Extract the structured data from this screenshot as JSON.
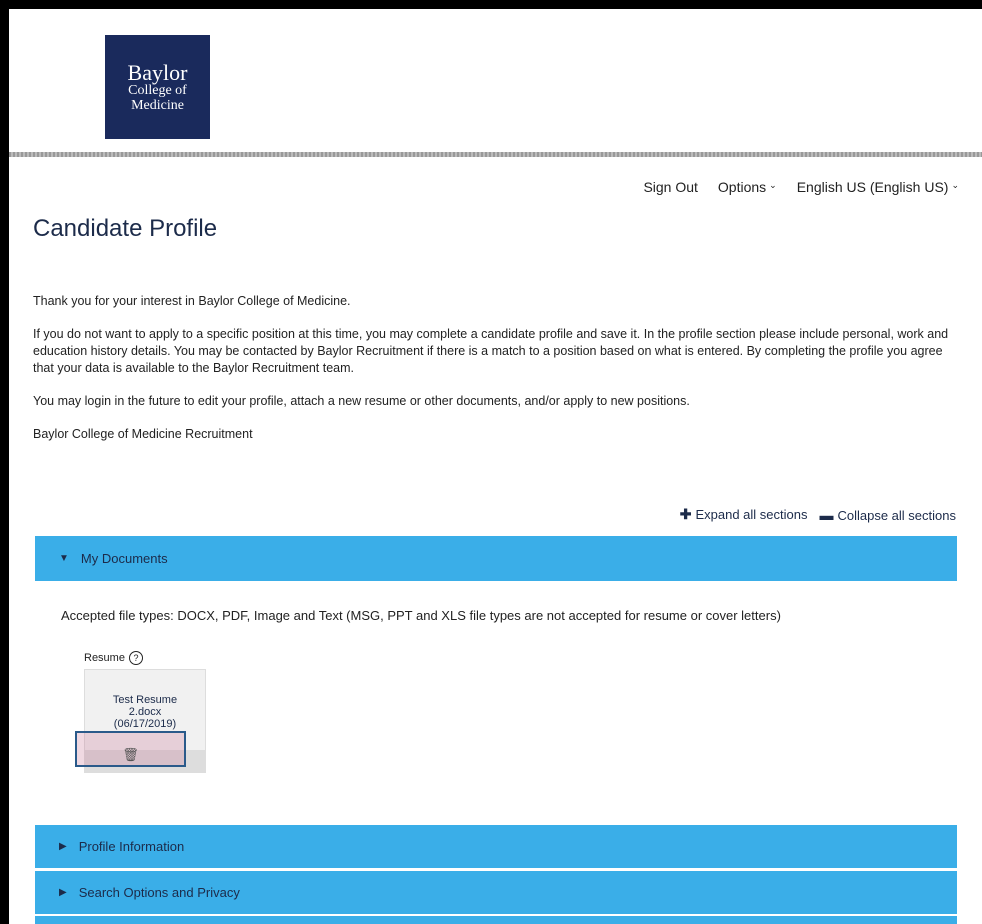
{
  "logo": {
    "line1": "Baylor",
    "line2": "College of",
    "line3": "Medicine"
  },
  "nav": {
    "sign_out": "Sign Out",
    "options": "Options",
    "language": "English US (English US)"
  },
  "page_title": "Candidate Profile",
  "intro": [
    "Thank you for your interest in Baylor College of Medicine.",
    "If you do not want to apply to a specific position at this time, you may complete a candidate profile and save it. In the profile section please include personal, work and education history details. You may be contacted by Baylor Recruitment if there is a match to a position based on what is entered. By completing the profile you agree that your data is available to the Baylor Recruitment team.",
    "You may login in the future to edit your profile, attach a new resume or other documents, and/or apply to new positions.",
    "Baylor College of Medicine Recruitment"
  ],
  "toggles": {
    "expand": "Expand all sections",
    "collapse": "Collapse all sections"
  },
  "sections": {
    "documents": "My Documents",
    "profile": "Profile Information",
    "search": "Search Options and Privacy"
  },
  "documents": {
    "accepted_types": "Accepted file types: DOCX, PDF, Image and Text (MSG, PPT and XLS file types are not accepted for resume or cover letters)",
    "resume_label": "Resume",
    "file_name_line1": "Test Resume",
    "file_name_line2": "2.docx",
    "file_date": "(06/17/2019)"
  },
  "colors": {
    "accent": "#3aaee8",
    "brand": "#1a2a5c",
    "highlight_border": "#2a5a8a"
  }
}
